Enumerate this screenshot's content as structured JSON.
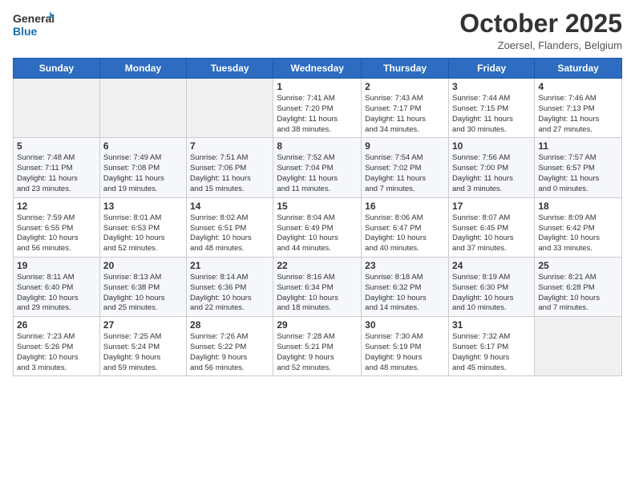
{
  "header": {
    "logo_line1": "General",
    "logo_line2": "Blue",
    "month_title": "October 2025",
    "location": "Zoersel, Flanders, Belgium"
  },
  "weekdays": [
    "Sunday",
    "Monday",
    "Tuesday",
    "Wednesday",
    "Thursday",
    "Friday",
    "Saturday"
  ],
  "weeks": [
    [
      {
        "day": "",
        "info": ""
      },
      {
        "day": "",
        "info": ""
      },
      {
        "day": "",
        "info": ""
      },
      {
        "day": "1",
        "info": "Sunrise: 7:41 AM\nSunset: 7:20 PM\nDaylight: 11 hours\nand 38 minutes."
      },
      {
        "day": "2",
        "info": "Sunrise: 7:43 AM\nSunset: 7:17 PM\nDaylight: 11 hours\nand 34 minutes."
      },
      {
        "day": "3",
        "info": "Sunrise: 7:44 AM\nSunset: 7:15 PM\nDaylight: 11 hours\nand 30 minutes."
      },
      {
        "day": "4",
        "info": "Sunrise: 7:46 AM\nSunset: 7:13 PM\nDaylight: 11 hours\nand 27 minutes."
      }
    ],
    [
      {
        "day": "5",
        "info": "Sunrise: 7:48 AM\nSunset: 7:11 PM\nDaylight: 11 hours\nand 23 minutes."
      },
      {
        "day": "6",
        "info": "Sunrise: 7:49 AM\nSunset: 7:08 PM\nDaylight: 11 hours\nand 19 minutes."
      },
      {
        "day": "7",
        "info": "Sunrise: 7:51 AM\nSunset: 7:06 PM\nDaylight: 11 hours\nand 15 minutes."
      },
      {
        "day": "8",
        "info": "Sunrise: 7:52 AM\nSunset: 7:04 PM\nDaylight: 11 hours\nand 11 minutes."
      },
      {
        "day": "9",
        "info": "Sunrise: 7:54 AM\nSunset: 7:02 PM\nDaylight: 11 hours\nand 7 minutes."
      },
      {
        "day": "10",
        "info": "Sunrise: 7:56 AM\nSunset: 7:00 PM\nDaylight: 11 hours\nand 3 minutes."
      },
      {
        "day": "11",
        "info": "Sunrise: 7:57 AM\nSunset: 6:57 PM\nDaylight: 11 hours\nand 0 minutes."
      }
    ],
    [
      {
        "day": "12",
        "info": "Sunrise: 7:59 AM\nSunset: 6:55 PM\nDaylight: 10 hours\nand 56 minutes."
      },
      {
        "day": "13",
        "info": "Sunrise: 8:01 AM\nSunset: 6:53 PM\nDaylight: 10 hours\nand 52 minutes."
      },
      {
        "day": "14",
        "info": "Sunrise: 8:02 AM\nSunset: 6:51 PM\nDaylight: 10 hours\nand 48 minutes."
      },
      {
        "day": "15",
        "info": "Sunrise: 8:04 AM\nSunset: 6:49 PM\nDaylight: 10 hours\nand 44 minutes."
      },
      {
        "day": "16",
        "info": "Sunrise: 8:06 AM\nSunset: 6:47 PM\nDaylight: 10 hours\nand 40 minutes."
      },
      {
        "day": "17",
        "info": "Sunrise: 8:07 AM\nSunset: 6:45 PM\nDaylight: 10 hours\nand 37 minutes."
      },
      {
        "day": "18",
        "info": "Sunrise: 8:09 AM\nSunset: 6:42 PM\nDaylight: 10 hours\nand 33 minutes."
      }
    ],
    [
      {
        "day": "19",
        "info": "Sunrise: 8:11 AM\nSunset: 6:40 PM\nDaylight: 10 hours\nand 29 minutes."
      },
      {
        "day": "20",
        "info": "Sunrise: 8:13 AM\nSunset: 6:38 PM\nDaylight: 10 hours\nand 25 minutes."
      },
      {
        "day": "21",
        "info": "Sunrise: 8:14 AM\nSunset: 6:36 PM\nDaylight: 10 hours\nand 22 minutes."
      },
      {
        "day": "22",
        "info": "Sunrise: 8:16 AM\nSunset: 6:34 PM\nDaylight: 10 hours\nand 18 minutes."
      },
      {
        "day": "23",
        "info": "Sunrise: 8:18 AM\nSunset: 6:32 PM\nDaylight: 10 hours\nand 14 minutes."
      },
      {
        "day": "24",
        "info": "Sunrise: 8:19 AM\nSunset: 6:30 PM\nDaylight: 10 hours\nand 10 minutes."
      },
      {
        "day": "25",
        "info": "Sunrise: 8:21 AM\nSunset: 6:28 PM\nDaylight: 10 hours\nand 7 minutes."
      }
    ],
    [
      {
        "day": "26",
        "info": "Sunrise: 7:23 AM\nSunset: 5:26 PM\nDaylight: 10 hours\nand 3 minutes."
      },
      {
        "day": "27",
        "info": "Sunrise: 7:25 AM\nSunset: 5:24 PM\nDaylight: 9 hours\nand 59 minutes."
      },
      {
        "day": "28",
        "info": "Sunrise: 7:26 AM\nSunset: 5:22 PM\nDaylight: 9 hours\nand 56 minutes."
      },
      {
        "day": "29",
        "info": "Sunrise: 7:28 AM\nSunset: 5:21 PM\nDaylight: 9 hours\nand 52 minutes."
      },
      {
        "day": "30",
        "info": "Sunrise: 7:30 AM\nSunset: 5:19 PM\nDaylight: 9 hours\nand 48 minutes."
      },
      {
        "day": "31",
        "info": "Sunrise: 7:32 AM\nSunset: 5:17 PM\nDaylight: 9 hours\nand 45 minutes."
      },
      {
        "day": "",
        "info": ""
      }
    ]
  ]
}
